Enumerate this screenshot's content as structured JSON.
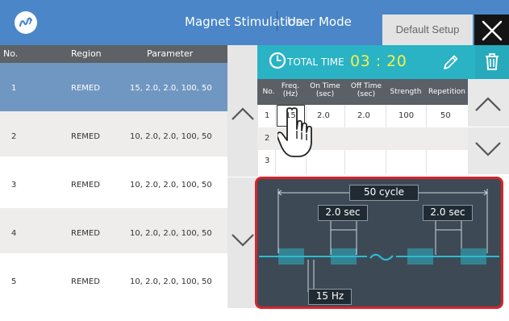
{
  "header": {
    "app_title": "Magnet Stimulation",
    "mode": "User Mode",
    "default_setup_label": "Default Setup",
    "colors": {
      "bar": "#4a86c8"
    }
  },
  "protocol_list": {
    "columns": [
      "No.",
      "Region",
      "Parameter"
    ],
    "rows": [
      {
        "no": "1",
        "region": "REMED",
        "parameter": "15, 2.0,  2.0, 100,  50",
        "selected": true
      },
      {
        "no": "2",
        "region": "REMED",
        "parameter": "10, 2.0,  2.0, 100,  50"
      },
      {
        "no": "3",
        "region": "REMED",
        "parameter": "10, 2.0,  2.0, 100,  50"
      },
      {
        "no": "4",
        "region": "REMED",
        "parameter": "10, 2.0,  2.0, 100,  50"
      },
      {
        "no": "5",
        "region": "REMED",
        "parameter": "10, 2.0,  2.0, 100,  50"
      }
    ]
  },
  "total_time": {
    "label": "TOTAL TIME",
    "value": "03 : 20"
  },
  "param_table": {
    "columns": [
      "No.",
      "Freq.\n(Hz)",
      "On Time\n(sec)",
      "Off Time\n(sec)",
      "Strength",
      "Repetition"
    ],
    "rows": [
      {
        "no": "1",
        "freq": "15",
        "on": "2.0",
        "off": "2.0",
        "strength": "100",
        "rep": "50"
      },
      {
        "no": "2",
        "freq": "",
        "on": "",
        "off": "",
        "strength": "",
        "rep": ""
      },
      {
        "no": "3",
        "freq": "",
        "on": "",
        "off": "",
        "strength": "",
        "rep": ""
      }
    ]
  },
  "diagram": {
    "cycle_label": "50 cycle",
    "on_time_label": "2.0 sec",
    "off_time_label": "2.0 sec",
    "freq_label": "15 Hz",
    "colors": {
      "background": "#3d4a56",
      "signal": "#2bbcd0",
      "border": "#d8232a"
    }
  }
}
